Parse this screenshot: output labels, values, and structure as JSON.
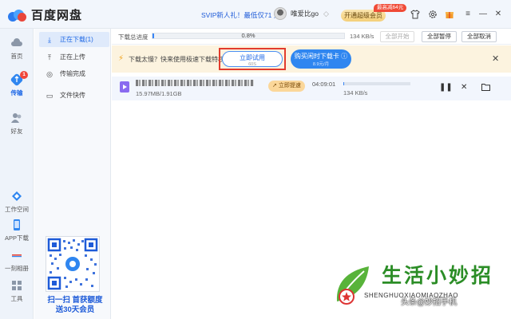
{
  "app": {
    "name": "百度网盘"
  },
  "titlebar": {
    "svip_promo": "SVIP新人礼！最低仅71 元",
    "username": "唯爱比go",
    "upgrade_label": "开通超级会员",
    "promo_badge": "最高减64元",
    "icons": [
      "shirt-icon",
      "gear-icon",
      "gift-icon",
      "menu-icon",
      "minimize-icon",
      "maximize-icon",
      "close-icon"
    ]
  },
  "sidebar": {
    "items": [
      {
        "label": "首页",
        "icon": "cloud-icon"
      },
      {
        "label": "传输",
        "icon": "transfer-icon",
        "badge": "1",
        "active": true
      },
      {
        "label": "好友",
        "icon": "friends-icon"
      },
      {
        "label": "工作空间",
        "icon": "workspace-icon"
      },
      {
        "label": "APP下载",
        "icon": "phone-icon"
      },
      {
        "label": "一刻相册",
        "icon": "album-icon"
      },
      {
        "label": "工具",
        "icon": "tools-icon"
      }
    ]
  },
  "submenu": {
    "items": [
      {
        "label": "正在下载(1)",
        "icon": "download-icon",
        "active": true
      },
      {
        "label": "正在上传",
        "icon": "upload-icon"
      },
      {
        "label": "传输完成",
        "icon": "check-circle-icon"
      },
      {
        "label": "文件快传",
        "icon": "monitor-icon"
      }
    ],
    "qr_caption_line1": "扫一扫 首获额度",
    "qr_caption_line2": "送30天会员"
  },
  "main": {
    "progress_label": "下载总进度",
    "progress_percent": "0.8%",
    "progress_value": 0.008,
    "total_speed": "134 KB/s",
    "btn_start_all": "全部开始",
    "btn_pause_all": "全部暂停",
    "btn_cancel_all": "全部取消",
    "banner_text": "下载太慢？快来使用极速下载特权",
    "try_label": "立即试用",
    "try_sub": "60S",
    "buy_label": "购买闲时下载卡",
    "buy_sub": "8.9元/月",
    "task": {
      "size": "15.97MB/1.91GB",
      "boost_label": "立即提速",
      "time_left": "04:09:01",
      "speed": "134 KB/s",
      "progress_value": 0.008
    }
  },
  "watermark": {
    "title": "生活小妙招",
    "subtitle": "SHENGHUOXIAOMIAOZHAO",
    "tag": "头条@妙招手机"
  },
  "colors": {
    "accent": "#1e68e6",
    "highlight_border": "#e23b2c",
    "banner_bg": "#fcf3df"
  }
}
